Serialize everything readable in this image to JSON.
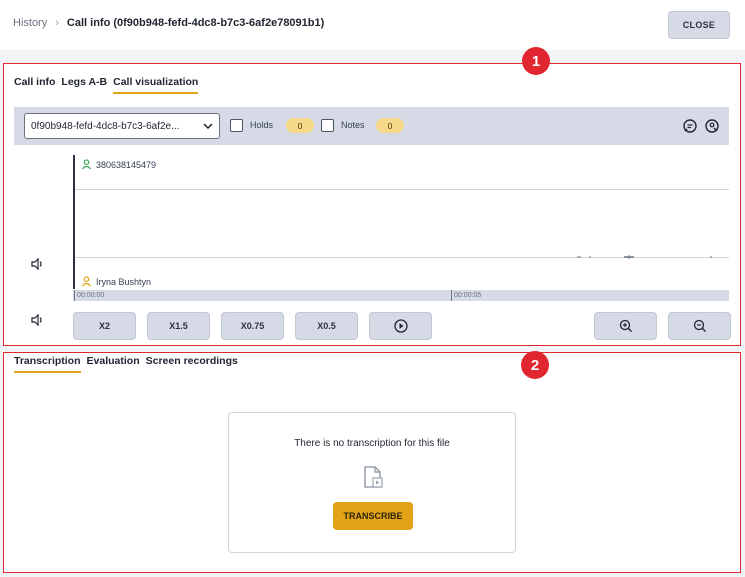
{
  "breadcrumb": {
    "history": "History",
    "separator": "›",
    "current": "Call info (0f90b948-fefd-4dc8-b7c3-6af2e78091b1)"
  },
  "header": {
    "close_label": "CLOSE"
  },
  "badges": {
    "one": "1",
    "two": "2"
  },
  "call_tabs": [
    {
      "label": "Call info",
      "active": false
    },
    {
      "label": "Legs A-B",
      "active": false
    },
    {
      "label": "Call visualization",
      "active": true
    }
  ],
  "toolbar": {
    "leg_select_value": "0f90b948-fefd-4dc8-b7c3-6af2e...",
    "holds_label": "Holds",
    "holds_count": "0",
    "holds_checked": false,
    "notes_label": "Notes",
    "notes_count": "0",
    "notes_checked": false,
    "icons": [
      "comment-icon",
      "location-icon"
    ]
  },
  "visualization": {
    "participant_top": "380638145479",
    "participant_bottom": "Iryna Bushtyn",
    "timeline_ticks": [
      "00:00:00",
      "00:00:05"
    ],
    "colors": {
      "top_participant": "#3aa655",
      "bottom_participant": "#e2a316"
    }
  },
  "playback": {
    "speeds": [
      "X2",
      "X1.5",
      "X0.75",
      "X0.5"
    ],
    "play_icon": "play-icon",
    "zoom_in_icon": "zoom-in-icon",
    "zoom_out_icon": "zoom-out-icon"
  },
  "bottom_tabs": [
    {
      "label": "Transcription",
      "active": true
    },
    {
      "label": "Evaluation",
      "active": false
    },
    {
      "label": "Screen recordings",
      "active": false
    }
  ],
  "transcription": {
    "empty_message": "There is no transcription for this file",
    "transcribe_label": "TRANSCRIBE"
  },
  "colors": {
    "accent": "#e2a316",
    "highlight_border": "#e0262f",
    "toolbar_bg": "#d6dae6"
  }
}
